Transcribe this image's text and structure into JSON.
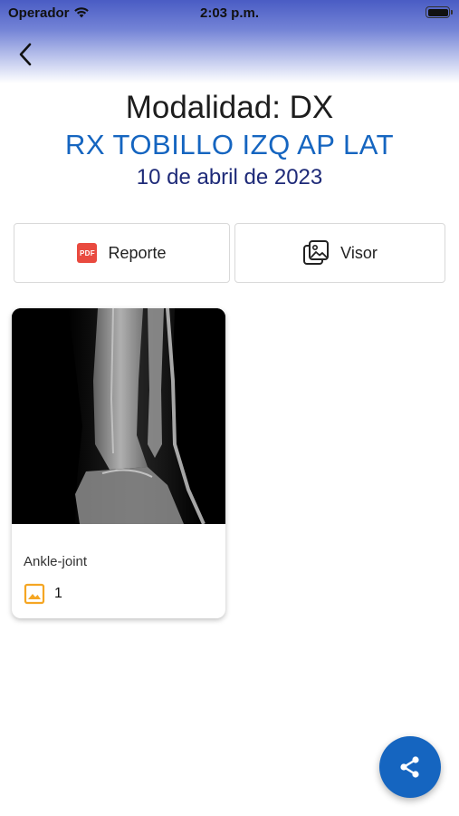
{
  "status_bar": {
    "carrier": "Operador",
    "time": "2:03 p.m.",
    "icons": [
      "wifi-icon",
      "battery-icon"
    ]
  },
  "navigation": {
    "back_icon": "chevron-left-icon"
  },
  "study": {
    "modality": "Modalidad: DX",
    "name": "RX TOBILLO IZQ AP LAT",
    "date": "10 de abril de 2023"
  },
  "actions": {
    "report_label": "Reporte",
    "report_icon": "pdf-icon",
    "report_icon_text": "PDF",
    "viewer_label": "Visor",
    "viewer_icon": "images-icon"
  },
  "series": [
    {
      "label": "Ankle-joint",
      "image_count": "1",
      "thumbnail": "ankle-xray-thumbnail",
      "count_icon": "image-icon"
    }
  ],
  "fab": {
    "icon": "share-icon"
  },
  "colors": {
    "primary": "#1565c0",
    "date_text": "#1e2a78",
    "count_icon": "#f5a623",
    "pdf_icon": "#e94a3f",
    "header_gradient_top": "#4a5cc4"
  }
}
